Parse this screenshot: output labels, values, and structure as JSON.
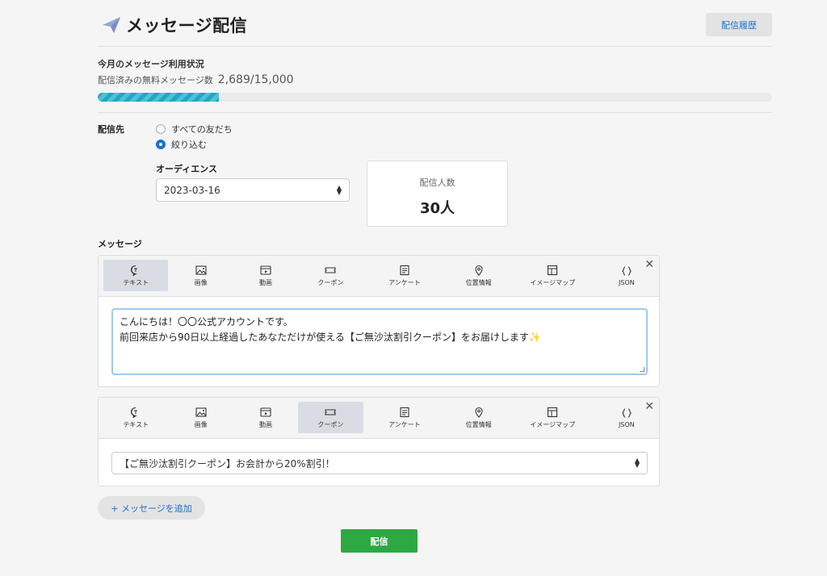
{
  "header": {
    "title": "メッセージ配信",
    "history_button": "配信履歴"
  },
  "usage": {
    "heading": "今月のメッセージ利用状況",
    "label": "配信済みの無料メッセージ数",
    "count": "2,689/15,000",
    "used": 2689,
    "limit": 15000
  },
  "recipients": {
    "label": "配信先",
    "options": [
      "すべての友だち",
      "絞り込む"
    ],
    "selected_index": 1
  },
  "audience": {
    "label": "オーディエンス",
    "value": "2023-03-16"
  },
  "recipient_count": {
    "label": "配信人数",
    "value": "30人"
  },
  "message_section": {
    "label": "メッセージ"
  },
  "tabs": [
    "テキスト",
    "画像",
    "動画",
    "クーポン",
    "アンケート",
    "位置情報",
    "イメージマップ",
    "JSON"
  ],
  "messages": [
    {
      "active_tab": "テキスト",
      "text": "こんにちは！〇〇公式アカウントです。\n前回来店から90日以上経過したあなただけが使える【ご無沙汰割引クーポン】をお届けします✨"
    },
    {
      "active_tab": "クーポン",
      "coupon": "【ご無沙汰割引クーポン】お会計から20%割引！"
    }
  ],
  "close_glyph": "✕",
  "add_button": "+ メッセージを追加",
  "send_button": "配信",
  "colors": {
    "accent": "#1a6fd1",
    "progress": "#20a8c1",
    "send": "#2ea843"
  }
}
